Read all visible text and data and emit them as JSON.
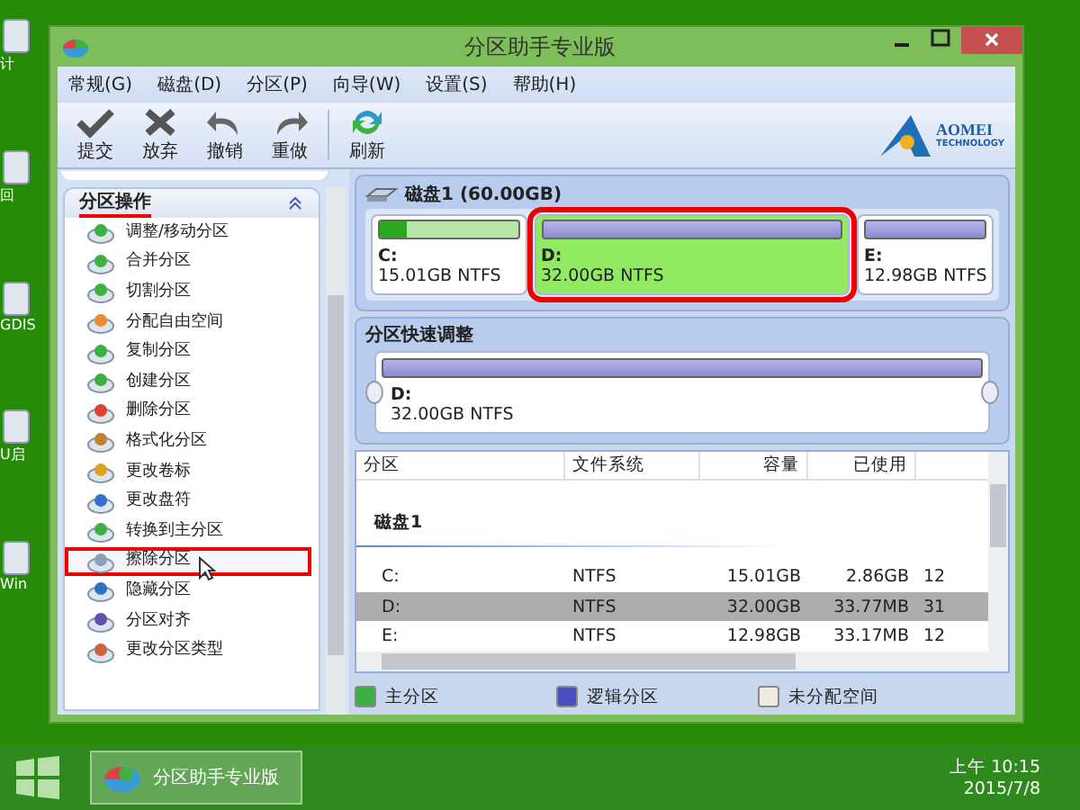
{
  "desktop_icons": [
    {
      "label": "计"
    },
    {
      "label": "回"
    },
    {
      "label": "GDIS"
    },
    {
      "label": "U启"
    },
    {
      "label": "Win"
    }
  ],
  "window": {
    "title": "分区助手专业版"
  },
  "menu": [
    "常规(G)",
    "磁盘(D)",
    "分区(P)",
    "向导(W)",
    "设置(S)",
    "帮助(H)"
  ],
  "toolbar": [
    "提交",
    "放弃",
    "撤销",
    "重做",
    "刷新"
  ],
  "logo": {
    "name": "AOMEI",
    "sub": "TECHNOLOGY"
  },
  "sidebar": {
    "title": "分区操作",
    "items": [
      {
        "label": "调整/移动分区",
        "selected": false
      },
      {
        "label": "合并分区",
        "selected": false
      },
      {
        "label": "切割分区",
        "selected": false
      },
      {
        "label": "分配自由空间",
        "selected": false
      },
      {
        "label": "复制分区",
        "selected": false
      },
      {
        "label": "创建分区",
        "selected": false
      },
      {
        "label": "删除分区",
        "selected": false
      },
      {
        "label": "格式化分区",
        "selected": false
      },
      {
        "label": "更改卷标",
        "selected": false
      },
      {
        "label": "更改盘符",
        "selected": false
      },
      {
        "label": "转换到主分区",
        "selected": false
      },
      {
        "label": "擦除分区",
        "selected": true
      },
      {
        "label": "隐藏分区",
        "selected": false
      },
      {
        "label": "分区对齐",
        "selected": false
      },
      {
        "label": "更改分区类型",
        "selected": false
      }
    ]
  },
  "disk_map": {
    "title": "磁盘1 (60.00GB)",
    "partitions": [
      {
        "letter": "C:",
        "info": "15.01GB NTFS",
        "kind": "primary",
        "level": 0.19,
        "selected": false
      },
      {
        "letter": "D:",
        "info": "32.00GB NTFS",
        "kind": "logical",
        "selected": true
      },
      {
        "letter": "E:",
        "info": "12.98GB NTFS",
        "kind": "logical",
        "selected": false
      }
    ]
  },
  "quick_adjust": {
    "title": "分区快速调整",
    "letter": "D:",
    "info": "32.00GB NTFS"
  },
  "table": {
    "columns": [
      "分区",
      "文件系统",
      "容量",
      "已使用"
    ],
    "group": "磁盘1",
    "rows": [
      {
        "cells": [
          "C:",
          "NTFS",
          "15.01GB",
          "2.86GB",
          "12"
        ],
        "selected": false
      },
      {
        "cells": [
          "D:",
          "NTFS",
          "32.00GB",
          "33.77MB",
          "31"
        ],
        "selected": true
      },
      {
        "cells": [
          "E:",
          "NTFS",
          "12.98GB",
          "33.17MB",
          "12"
        ],
        "selected": false
      }
    ]
  },
  "legend": [
    {
      "label": "主分区",
      "color": "#3cb043"
    },
    {
      "label": "逻辑分区",
      "color": "#4a4ec0"
    },
    {
      "label": "未分配空间",
      "color": "#f0ebe0"
    }
  ],
  "taskbar": {
    "task": "分区助手专业版",
    "time": "上午 10:15",
    "date": "2015/7/8"
  }
}
